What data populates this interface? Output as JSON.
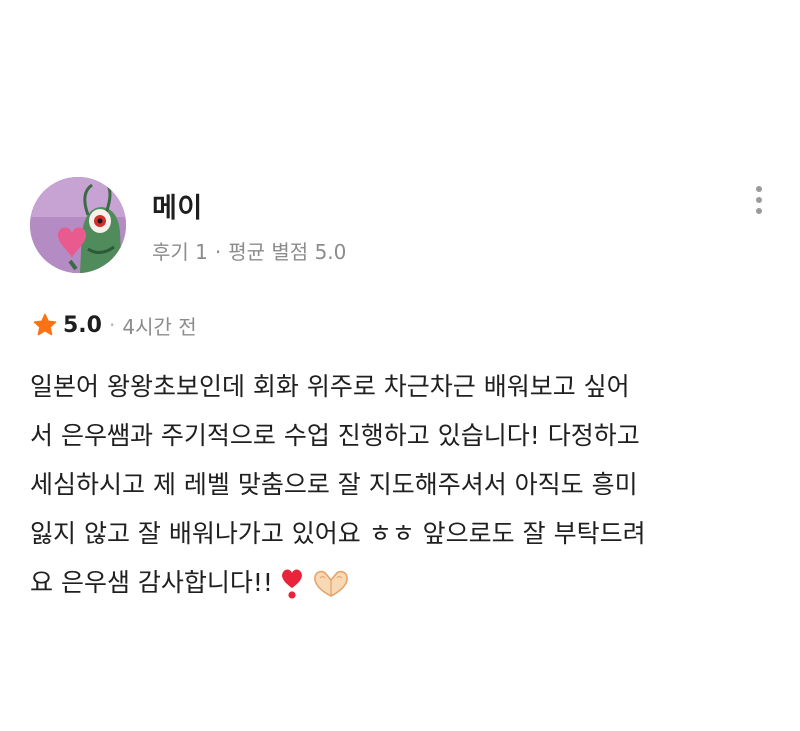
{
  "reviewer": {
    "name": "메이",
    "review_count": "후기 1",
    "meta_separator": "·",
    "average_rating": "평균 별점 5.0",
    "avatar": "plankton-avatar"
  },
  "more_menu_icon": "more-vertical-icon",
  "review": {
    "star_icon": "star-icon",
    "star_color": "#f97316",
    "rating": "5.0",
    "separator": "·",
    "time_ago": "4시간 전",
    "text_lines": [
      "일본어 왕왕초보인데 회화 위주로 차근차근 배워보고 싶어",
      "서 은우쌤과 주기적으로 수업 진행하고 있습니다! 다정하고",
      "세심하시고 제 레벨 맞춤으로 잘 지도해주셔서 아직도 흥미",
      "잃지 않고 잘 배워나가고 있어요 ㅎㅎ 앞으로도 잘 부탁드려",
      "요 은우샘 감사합니다!!"
    ],
    "emojis": [
      "heart-exclamation-emoji",
      "heart-hands-emoji"
    ]
  }
}
